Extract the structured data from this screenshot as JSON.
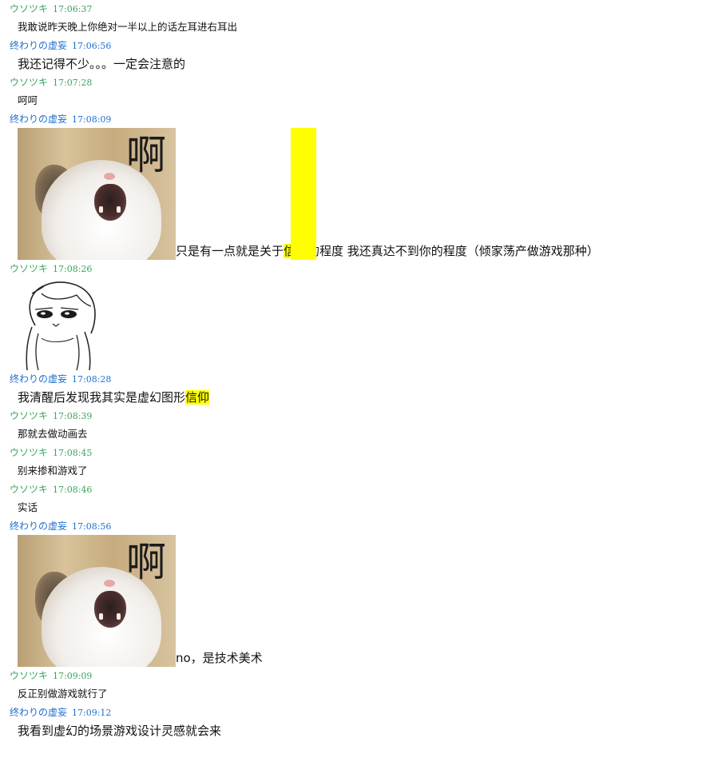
{
  "users": {
    "a": "ウソツキ",
    "b": "终わりの虚妄"
  },
  "messages": [
    {
      "time": "17:06:37",
      "text": "我敢说昨天晚上你绝对一半以上的话左耳进右耳出"
    },
    {
      "time": "17:06:56",
      "text": "我还记得不少。。。一定会注意的"
    },
    {
      "time": "17:07:28",
      "text": "呵呵"
    },
    {
      "time": "17:08:09",
      "caption_pre": "只是有一点就是关于",
      "caption_hl": "信仰",
      "caption_post": "的程度 我还真达不到你的程度（倾家荡产做游戏那种）",
      "image_text": "啊"
    },
    {
      "time": "17:08:26"
    },
    {
      "time": "17:08:28",
      "text_pre": "我清醒后发现我其实是虚幻图形",
      "text_hl": "信仰"
    },
    {
      "time": "17:08:39",
      "text": "那就去做动画去"
    },
    {
      "time": "17:08:45",
      "text": "别来掺和游戏了"
    },
    {
      "time": "17:08:46",
      "text": "实话"
    },
    {
      "time": "17:08:56",
      "caption": "no，是技术美术",
      "image_text": "啊"
    },
    {
      "time": "17:09:09",
      "text": "反正别做游戏就行了"
    },
    {
      "time": "17:09:12",
      "text": "我看到虚幻的场景游戏设计灵感就会来"
    }
  ]
}
